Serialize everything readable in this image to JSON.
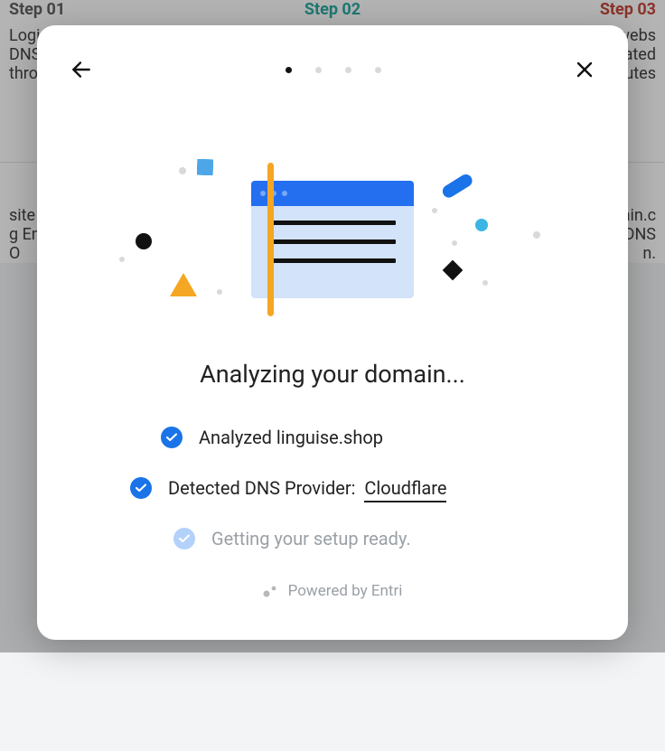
{
  "background": {
    "step1": {
      "label": "Step 01",
      "line1": "Logi",
      "line2": "DNS",
      "line3": "thro"
    },
    "step2": {
      "label": "Step 02"
    },
    "step3": {
      "label": "Step 03",
      "line1": "webs",
      "line2": "ated",
      "line3": "utes"
    },
    "hint_left_1": "site",
    "hint_left_2": "g Ent",
    "hint_left_3": "O",
    "hint_right_1": "ain.c",
    "hint_right_2": "DNS",
    "hint_right_3": "n."
  },
  "modal": {
    "heading": "Analyzing your domain...",
    "items": {
      "analyzed_prefix": "Analyzed ",
      "analyzed_domain": "linguise.shop",
      "detected_label": "Detected DNS Provider:",
      "detected_provider": "Cloudflare",
      "pending": "Getting your setup ready."
    },
    "footer": "Powered by Entri",
    "progress": {
      "total": 4,
      "active_index": 0
    }
  }
}
